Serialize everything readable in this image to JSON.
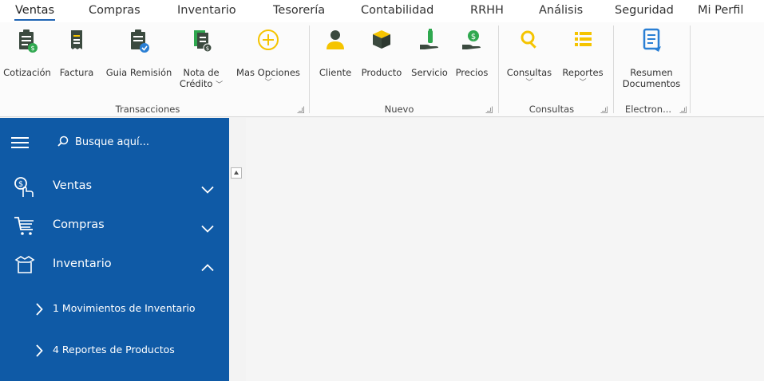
{
  "menu": {
    "tabs": [
      "Ventas",
      "Compras",
      "Inventario",
      "Tesorería",
      "Contabilidad",
      "RRHH",
      "Análisis",
      "Seguridad",
      "Mi Perfil"
    ],
    "active": "Ventas"
  },
  "ribbon": {
    "groups": {
      "transacciones": "Transacciones",
      "nuevo": "Nuevo",
      "consultas": "Consultas",
      "electronico": "Electron..."
    },
    "buttons": {
      "cotizacion": "Cotización",
      "factura": "Factura",
      "guia_remision": "Guia Remisión",
      "nota_credito_1": "Nota de",
      "nota_credito_2": "Crédito",
      "mas_opciones": "Mas Opciones",
      "cliente": "Cliente",
      "producto": "Producto",
      "servicio": "Servicio",
      "precios": "Precios",
      "consultas": "Consultas",
      "reportes": "Reportes",
      "resumen_1": "Resumen",
      "resumen_2": "Documentos"
    },
    "colors": {
      "icon_dark": "#3b4a3f",
      "icon_green": "#2fa84f",
      "icon_yellow": "#f5c400",
      "icon_blue": "#2a7fd4"
    }
  },
  "sidebar": {
    "search_placeholder": "Busque aquí...",
    "items": [
      {
        "label": "Ventas",
        "icon": "money-hand-icon",
        "expanded": false
      },
      {
        "label": "Compras",
        "icon": "cart-icon",
        "expanded": false
      },
      {
        "label": "Inventario",
        "icon": "box-icon",
        "expanded": true
      }
    ],
    "subitems": [
      "1 Movimientos de Inventario",
      "4 Reportes de Productos"
    ],
    "color": "#0f5aa6"
  }
}
